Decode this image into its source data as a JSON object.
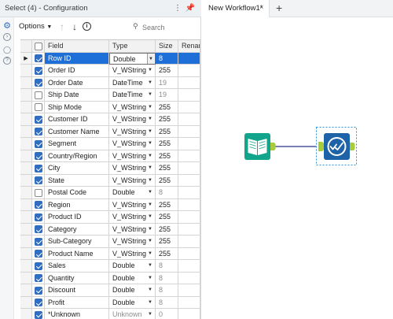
{
  "config": {
    "title": "Select (4) - Configuration",
    "options_label": "Options",
    "search_placeholder": "Search"
  },
  "grid": {
    "headers": {
      "field": "Field",
      "type": "Type",
      "size": "Size",
      "rename": "Rename"
    },
    "rows": [
      {
        "checked": true,
        "field": "Row ID",
        "type": "Double",
        "size": "8",
        "size_dim": false,
        "type_dim": false,
        "selected": true
      },
      {
        "checked": true,
        "field": "Order ID",
        "type": "V_WString",
        "size": "255",
        "size_dim": false,
        "type_dim": false
      },
      {
        "checked": true,
        "field": "Order Date",
        "type": "DateTime",
        "size": "19",
        "size_dim": true,
        "type_dim": false
      },
      {
        "checked": false,
        "field": "Ship Date",
        "type": "DateTime",
        "size": "19",
        "size_dim": true,
        "type_dim": false
      },
      {
        "checked": false,
        "field": "Ship Mode",
        "type": "V_WString",
        "size": "255",
        "size_dim": false,
        "type_dim": false
      },
      {
        "checked": true,
        "field": "Customer ID",
        "type": "V_WString",
        "size": "255",
        "size_dim": false,
        "type_dim": false
      },
      {
        "checked": true,
        "field": "Customer Name",
        "type": "V_WString",
        "size": "255",
        "size_dim": false,
        "type_dim": false
      },
      {
        "checked": true,
        "field": "Segment",
        "type": "V_WString",
        "size": "255",
        "size_dim": false,
        "type_dim": false
      },
      {
        "checked": true,
        "field": "Country/Region",
        "type": "V_WString",
        "size": "255",
        "size_dim": false,
        "type_dim": false
      },
      {
        "checked": true,
        "field": "City",
        "type": "V_WString",
        "size": "255",
        "size_dim": false,
        "type_dim": false
      },
      {
        "checked": true,
        "field": "State",
        "type": "V_WString",
        "size": "255",
        "size_dim": false,
        "type_dim": false
      },
      {
        "checked": false,
        "field": "Postal Code",
        "type": "Double",
        "size": "8",
        "size_dim": true,
        "type_dim": false
      },
      {
        "checked": true,
        "field": "Region",
        "type": "V_WString",
        "size": "255",
        "size_dim": false,
        "type_dim": false
      },
      {
        "checked": true,
        "field": "Product ID",
        "type": "V_WString",
        "size": "255",
        "size_dim": false,
        "type_dim": false
      },
      {
        "checked": true,
        "field": "Category",
        "type": "V_WString",
        "size": "255",
        "size_dim": false,
        "type_dim": false
      },
      {
        "checked": true,
        "field": "Sub-Category",
        "type": "V_WString",
        "size": "255",
        "size_dim": false,
        "type_dim": false
      },
      {
        "checked": true,
        "field": "Product Name",
        "type": "V_WString",
        "size": "255",
        "size_dim": false,
        "type_dim": false
      },
      {
        "checked": true,
        "field": "Sales",
        "type": "Double",
        "size": "8",
        "size_dim": true,
        "type_dim": false
      },
      {
        "checked": true,
        "field": "Quantity",
        "type": "Double",
        "size": "8",
        "size_dim": true,
        "type_dim": false
      },
      {
        "checked": true,
        "field": "Discount",
        "type": "Double",
        "size": "8",
        "size_dim": true,
        "type_dim": false
      },
      {
        "checked": true,
        "field": "Profit",
        "type": "Double",
        "size": "8",
        "size_dim": true,
        "type_dim": false
      },
      {
        "checked": true,
        "field": "*Unknown",
        "type": "Unknown",
        "size": "0",
        "size_dim": true,
        "type_dim": true
      }
    ]
  },
  "tabs": {
    "active_label": "New Workflow1*",
    "close_symbol": "×",
    "add_symbol": "+"
  },
  "colors": {
    "accent": "#1e6fd8",
    "checkbox": "#2f6ec1",
    "input_tool": "#12a58b",
    "select_tool": "#1e62a8",
    "anchor": "#a8cc3a",
    "connector": "#2b3590",
    "selection": "#2b8fd9"
  }
}
